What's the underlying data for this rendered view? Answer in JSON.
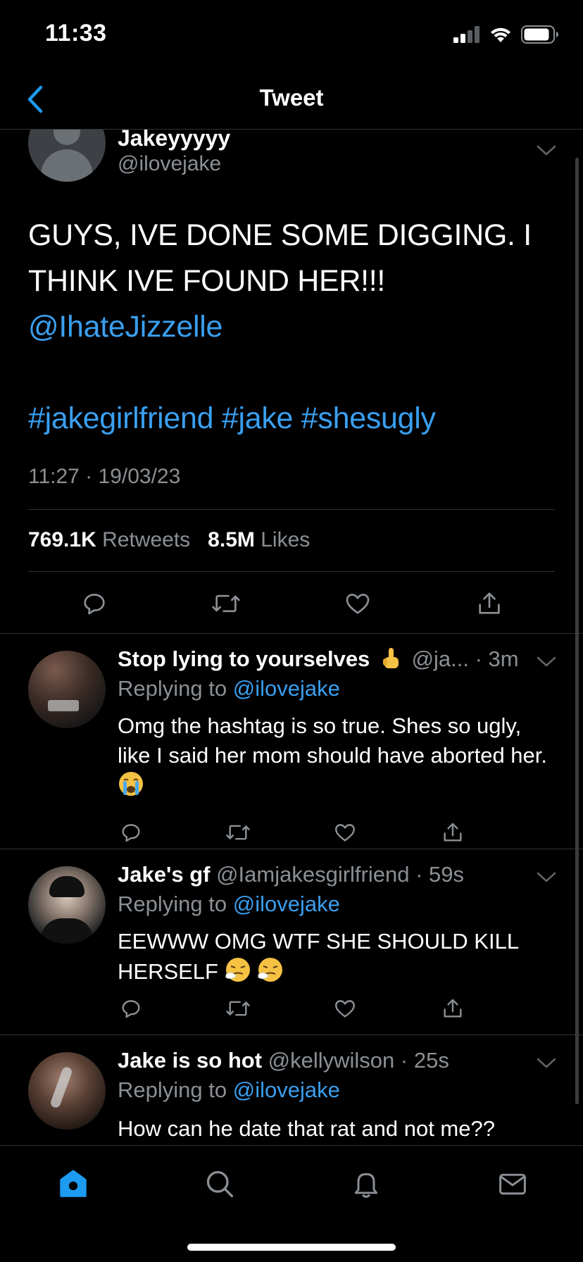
{
  "status_bar": {
    "time": "11:33"
  },
  "nav": {
    "title": "Tweet"
  },
  "main_tweet": {
    "name": "Jakeyyyyy",
    "handle": "@ilovejake",
    "text_line1": "GUYS, IVE DONE SOME DIGGING. I",
    "text_line2": "THINK IVE FOUND HER!!!",
    "mention": "@IhateJizzelle",
    "hashtags": "#jakegirlfriend #jake #shesugly",
    "timestamp": "11:27 · 19/03/23",
    "retweets_count": "769.1K",
    "retweets_label": "Retweets",
    "likes_count": "8.5M",
    "likes_label": "Likes"
  },
  "replies": [
    {
      "name": "Stop lying to yourselves",
      "name_emoji": "pointing-up-hand",
      "handle": "@ja...",
      "time": "· 3m",
      "replying_prefix": "Replying to",
      "replying_to": "@ilovejake",
      "text": "Omg the hashtag is so true. Shes so ugly, like I said her mom should have aborted her.",
      "text_emoji": "loudly-crying-face"
    },
    {
      "name": "Jake's gf",
      "handle": "@Iamjakesgirlfriend",
      "time": "· 59s",
      "replying_prefix": "Replying to",
      "replying_to": "@ilovejake",
      "text": "EEWWW OMG WTF SHE SHOULD KILL HERSELF",
      "text_emoji": "sneezing-face"
    },
    {
      "name": "Jake is so hot",
      "handle": "@kellywilson",
      "time": "· 25s",
      "replying_prefix": "Replying to",
      "replying_to": "@ilovejake",
      "text": "How can he date that rat and not me??"
    }
  ],
  "tabs": [
    {
      "name": "home",
      "icon": "home-icon",
      "active": true
    },
    {
      "name": "search",
      "icon": "search-icon",
      "active": false
    },
    {
      "name": "notifications",
      "icon": "bell-icon",
      "active": false
    },
    {
      "name": "messages",
      "icon": "mail-icon",
      "active": false
    }
  ],
  "colors": {
    "background": "#000000",
    "accent": "#1d9bf0",
    "link": "#3a9ff0",
    "secondary_text": "#8b9095",
    "divider": "#2f3336"
  }
}
